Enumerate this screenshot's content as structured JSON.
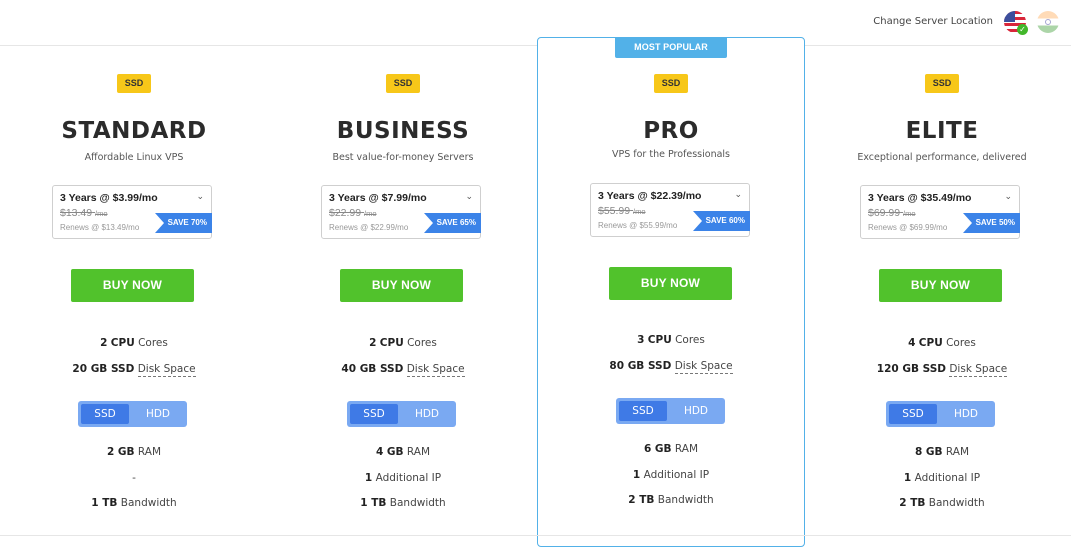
{
  "header": {
    "change_location_label": "Change Server Location",
    "flags": [
      "us-flag-icon",
      "india-flag-icon"
    ]
  },
  "popular_badge": "MOST POPULAR",
  "plans": [
    {
      "tag": "SSD",
      "name": "STANDARD",
      "subtitle": "Affordable Linux VPS",
      "term": "3 Years @ $3.99/mo",
      "old_price": "$13.49",
      "old_unit": "/mo",
      "renews": "Renews @ $13.49/mo",
      "save": "SAVE 70%",
      "buy": "BUY NOW",
      "cpu_value": "2",
      "cpu_bold": "CPU",
      "cpu_label": "Cores",
      "disk_bold": "20 GB SSD",
      "disk_label": "Disk Space",
      "toggle_ssd": "SSD",
      "toggle_hdd": "HDD",
      "ram_bold": "2 GB",
      "ram_label": "RAM",
      "ip_bold": "",
      "ip_label": "-",
      "bw_bold": "1 TB",
      "bw_label": "Bandwidth"
    },
    {
      "tag": "SSD",
      "name": "BUSINESS",
      "subtitle": "Best value-for-money Servers",
      "term": "3 Years @ $7.99/mo",
      "old_price": "$22.99",
      "old_unit": "/mo",
      "renews": "Renews @ $22.99/mo",
      "save": "SAVE 65%",
      "buy": "BUY NOW",
      "cpu_value": "2",
      "cpu_bold": "CPU",
      "cpu_label": "Cores",
      "disk_bold": "40 GB SSD",
      "disk_label": "Disk Space",
      "toggle_ssd": "SSD",
      "toggle_hdd": "HDD",
      "ram_bold": "4 GB",
      "ram_label": "RAM",
      "ip_bold": "1",
      "ip_label": "Additional IP",
      "bw_bold": "1 TB",
      "bw_label": "Bandwidth"
    },
    {
      "tag": "SSD",
      "name": "PRO",
      "subtitle": "VPS for the Professionals",
      "term": "3 Years @ $22.39/mo",
      "old_price": "$55.99",
      "old_unit": "/mo",
      "renews": "Renews @ $55.99/mo",
      "save": "SAVE 60%",
      "buy": "BUY NOW",
      "cpu_value": "3",
      "cpu_bold": "CPU",
      "cpu_label": "Cores",
      "disk_bold": "80 GB SSD",
      "disk_label": "Disk Space",
      "toggle_ssd": "SSD",
      "toggle_hdd": "HDD",
      "ram_bold": "6 GB",
      "ram_label": "RAM",
      "ip_bold": "1",
      "ip_label": "Additional IP",
      "bw_bold": "2 TB",
      "bw_label": "Bandwidth"
    },
    {
      "tag": "SSD",
      "name": "ELITE",
      "subtitle": "Exceptional performance, delivered",
      "term": "3 Years @ $35.49/mo",
      "old_price": "$69.99",
      "old_unit": "/mo",
      "renews": "Renews @ $69.99/mo",
      "save": "SAVE 50%",
      "buy": "BUY NOW",
      "cpu_value": "4",
      "cpu_bold": "CPU",
      "cpu_label": "Cores",
      "disk_bold": "120 GB SSD",
      "disk_label": "Disk Space",
      "toggle_ssd": "SSD",
      "toggle_hdd": "HDD",
      "ram_bold": "8 GB",
      "ram_label": "RAM",
      "ip_bold": "1",
      "ip_label": "Additional IP",
      "bw_bold": "2 TB",
      "bw_label": "Bandwidth"
    }
  ]
}
